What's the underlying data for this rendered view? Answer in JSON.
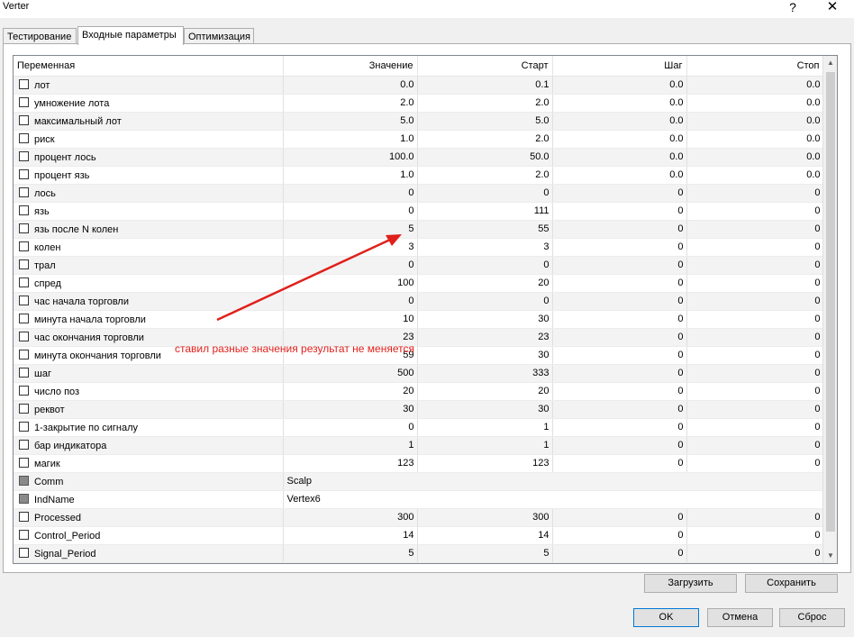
{
  "window": {
    "title": "Verter",
    "help": "?",
    "close": "✕"
  },
  "tabs": [
    {
      "label": "Тестирование",
      "active": false
    },
    {
      "label": "Входные параметры",
      "active": true
    },
    {
      "label": "Оптимизация",
      "active": false
    }
  ],
  "table": {
    "headers": {
      "var": "Переменная",
      "value": "Значение",
      "start": "Старт",
      "step": "Шаг",
      "stop": "Стоп"
    },
    "rows": [
      {
        "name": "лот",
        "value": "0.0",
        "start": "0.1",
        "step": "0.0",
        "stop": "0.0",
        "grey": false
      },
      {
        "name": "умножение лота",
        "value": "2.0",
        "start": "2.0",
        "step": "0.0",
        "stop": "0.0",
        "grey": false
      },
      {
        "name": "максимальный лот",
        "value": "5.0",
        "start": "5.0",
        "step": "0.0",
        "stop": "0.0",
        "grey": false
      },
      {
        "name": "риск",
        "value": "1.0",
        "start": "2.0",
        "step": "0.0",
        "stop": "0.0",
        "grey": false
      },
      {
        "name": "процент лось",
        "value": "100.0",
        "start": "50.0",
        "step": "0.0",
        "stop": "0.0",
        "grey": false
      },
      {
        "name": "процент язь",
        "value": "1.0",
        "start": "2.0",
        "step": "0.0",
        "stop": "0.0",
        "grey": false
      },
      {
        "name": "лось",
        "value": "0",
        "start": "0",
        "step": "0",
        "stop": "0",
        "grey": false
      },
      {
        "name": "язь",
        "value": "0",
        "start": "111",
        "step": "0",
        "stop": "0",
        "grey": false
      },
      {
        "name": "язь после N колен",
        "value": "5",
        "start": "55",
        "step": "0",
        "stop": "0",
        "grey": false
      },
      {
        "name": "колен",
        "value": "3",
        "start": "3",
        "step": "0",
        "stop": "0",
        "grey": false
      },
      {
        "name": "трал",
        "value": "0",
        "start": "0",
        "step": "0",
        "stop": "0",
        "grey": false
      },
      {
        "name": "спред",
        "value": "100",
        "start": "20",
        "step": "0",
        "stop": "0",
        "grey": false
      },
      {
        "name": "час начала торговли",
        "value": "0",
        "start": "0",
        "step": "0",
        "stop": "0",
        "grey": false
      },
      {
        "name": "минута начала торговли",
        "value": "10",
        "start": "30",
        "step": "0",
        "stop": "0",
        "grey": false
      },
      {
        "name": "час окончания торговли",
        "value": "23",
        "start": "23",
        "step": "0",
        "stop": "0",
        "grey": false
      },
      {
        "name": "минута окончания торговли",
        "value": "59",
        "start": "30",
        "step": "0",
        "stop": "0",
        "grey": false
      },
      {
        "name": "шаг",
        "value": "500",
        "start": "333",
        "step": "0",
        "stop": "0",
        "grey": false
      },
      {
        "name": "число поз",
        "value": "20",
        "start": "20",
        "step": "0",
        "stop": "0",
        "grey": false
      },
      {
        "name": "реквот",
        "value": "30",
        "start": "30",
        "step": "0",
        "stop": "0",
        "grey": false
      },
      {
        "name": "1-закрытие по сигналу",
        "value": "0",
        "start": "1",
        "step": "0",
        "stop": "0",
        "grey": false
      },
      {
        "name": "бар индикатора",
        "value": "1",
        "start": "1",
        "step": "0",
        "stop": "0",
        "grey": false
      },
      {
        "name": "магик",
        "value": "123",
        "start": "123",
        "step": "0",
        "stop": "0",
        "grey": false
      },
      {
        "name": "Comm",
        "value": "Scalp",
        "start": "",
        "step": "",
        "stop": "",
        "grey": true,
        "text": true
      },
      {
        "name": "IndName",
        "value": "Vertex6",
        "start": "",
        "step": "",
        "stop": "",
        "grey": true,
        "text": true
      },
      {
        "name": "Processed",
        "value": "300",
        "start": "300",
        "step": "0",
        "stop": "0",
        "grey": false
      },
      {
        "name": "Control_Period",
        "value": "14",
        "start": "14",
        "step": "0",
        "stop": "0",
        "grey": false
      },
      {
        "name": "Signal_Period",
        "value": "5",
        "start": "5",
        "step": "0",
        "stop": "0",
        "grey": false
      }
    ]
  },
  "annotation": {
    "text": "ставил разные значения результат не меняется",
    "color": "#e0201b"
  },
  "buttons": {
    "load": "Загрузить",
    "save": "Сохранить",
    "ok": "OK",
    "cancel": "Отмена",
    "reset": "Сброс"
  },
  "colors": {
    "accent": "#0078d7"
  }
}
